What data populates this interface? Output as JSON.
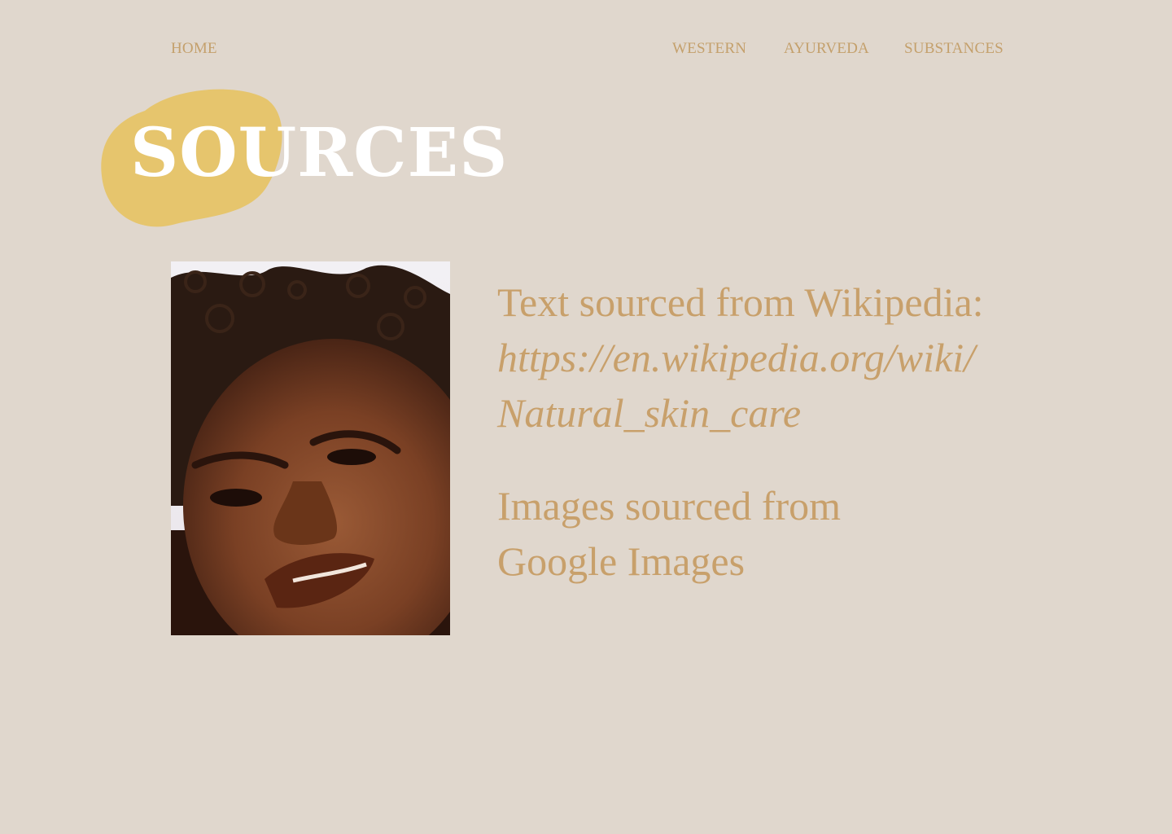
{
  "nav": {
    "home": "HOME",
    "items": [
      "WESTERN",
      "AYURVEDA",
      "SUBSTANCES"
    ]
  },
  "page_title": "SOURCES",
  "colors": {
    "background": "#e0d7cd",
    "accent_text": "#c8a06b",
    "blob": "#e6c56d",
    "title": "#ffffff"
  },
  "photo": {
    "icon": "portrait-photo"
  },
  "sources": {
    "text_label": "Text sourced from Wikipedia:",
    "text_url_part1": "https://en.wikipedia.org/wiki/",
    "text_url_part2": "Natural_skin_care",
    "images_label_line1": "Images sourced from",
    "images_label_line2": "Google Images"
  }
}
